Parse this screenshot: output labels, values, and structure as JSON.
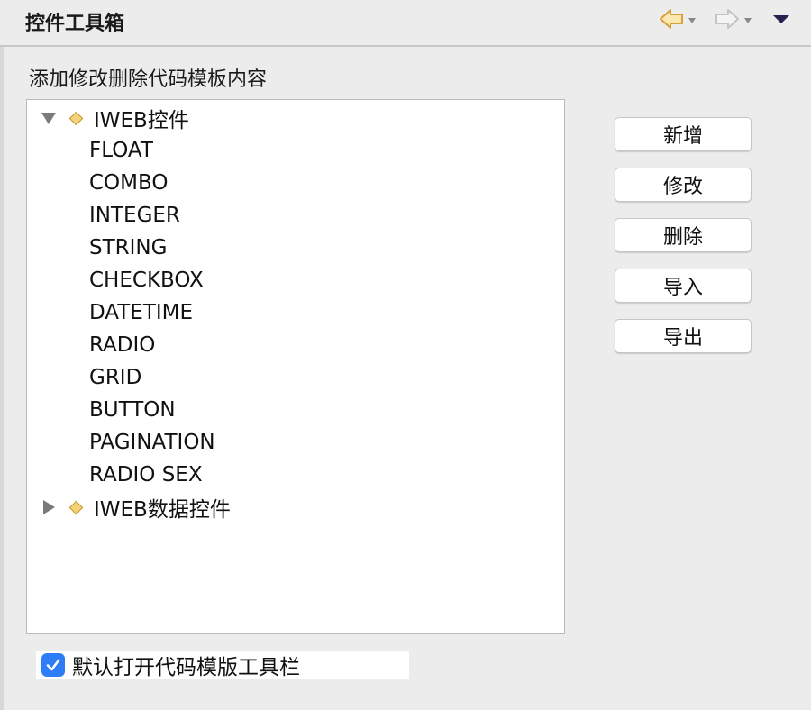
{
  "header": {
    "title": "控件工具箱",
    "back_icon": "back-arrow-icon",
    "forward_icon": "forward-arrow-icon",
    "menu_icon": "view-menu-icon"
  },
  "description": "添加修改删除代码模板内容",
  "tree": {
    "groups": [
      {
        "label": "IWEB控件",
        "expanded": true,
        "children": [
          "FLOAT",
          "COMBO",
          "INTEGER",
          "STRING",
          "CHECKBOX",
          "DATETIME",
          "RADIO",
          "GRID",
          "BUTTON",
          "PAGINATION",
          "RADIO SEX"
        ]
      },
      {
        "label": "IWEB数据控件",
        "expanded": false,
        "children": []
      }
    ]
  },
  "buttons": {
    "add": "新增",
    "edit": "修改",
    "delete": "删除",
    "import": "导入",
    "export": "导出"
  },
  "checkbox": {
    "label": "默认打开代码模版工具栏",
    "checked": true
  },
  "colors": {
    "accent": "#2e7cf6",
    "diamond_fill": "#f3d27c",
    "back_arrow": "#e0a838"
  }
}
